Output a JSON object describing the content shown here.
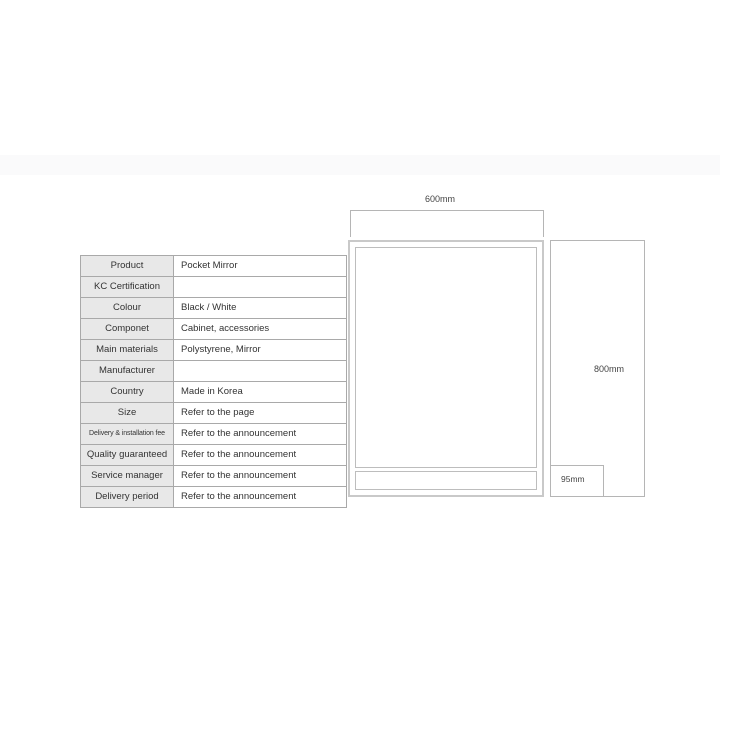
{
  "page": {
    "background_color": "#ffffff",
    "banner_color": "#fafafb"
  },
  "spec_table": {
    "name": "product-specification-table",
    "label_background": "#e8e8e8",
    "border_color": "#a9a9a9",
    "rows": [
      {
        "label": "Product",
        "value": "Pocket Mirror"
      },
      {
        "label": "KC Certification",
        "value": ""
      },
      {
        "label": "Colour",
        "value": "Black / White"
      },
      {
        "label": "Componet",
        "value": "Cabinet, accessories"
      },
      {
        "label": "Main materials",
        "value": "Polystyrene, Mirror"
      },
      {
        "label": "Manufacturer",
        "value": ""
      },
      {
        "label": "Country",
        "value": "Made in Korea"
      },
      {
        "label": "Size",
        "value": "Refer to the page"
      },
      {
        "label": "Delivery & installation fee",
        "value": "Refer to the announcement"
      },
      {
        "label": "Quality guaranteed",
        "value": "Refer to the announcement"
      },
      {
        "label": "Service manager",
        "value": "Refer to the announcement"
      },
      {
        "label": "Delivery period",
        "value": "Refer to the announcement"
      }
    ]
  },
  "drawing": {
    "name": "cabinet-dimension-drawing",
    "line_color": "#b5b5b5",
    "frame_color": "#c9c9c9",
    "dimensions": {
      "width_label": "600mm",
      "height_label": "800mm",
      "depth_label": "95mm"
    }
  }
}
